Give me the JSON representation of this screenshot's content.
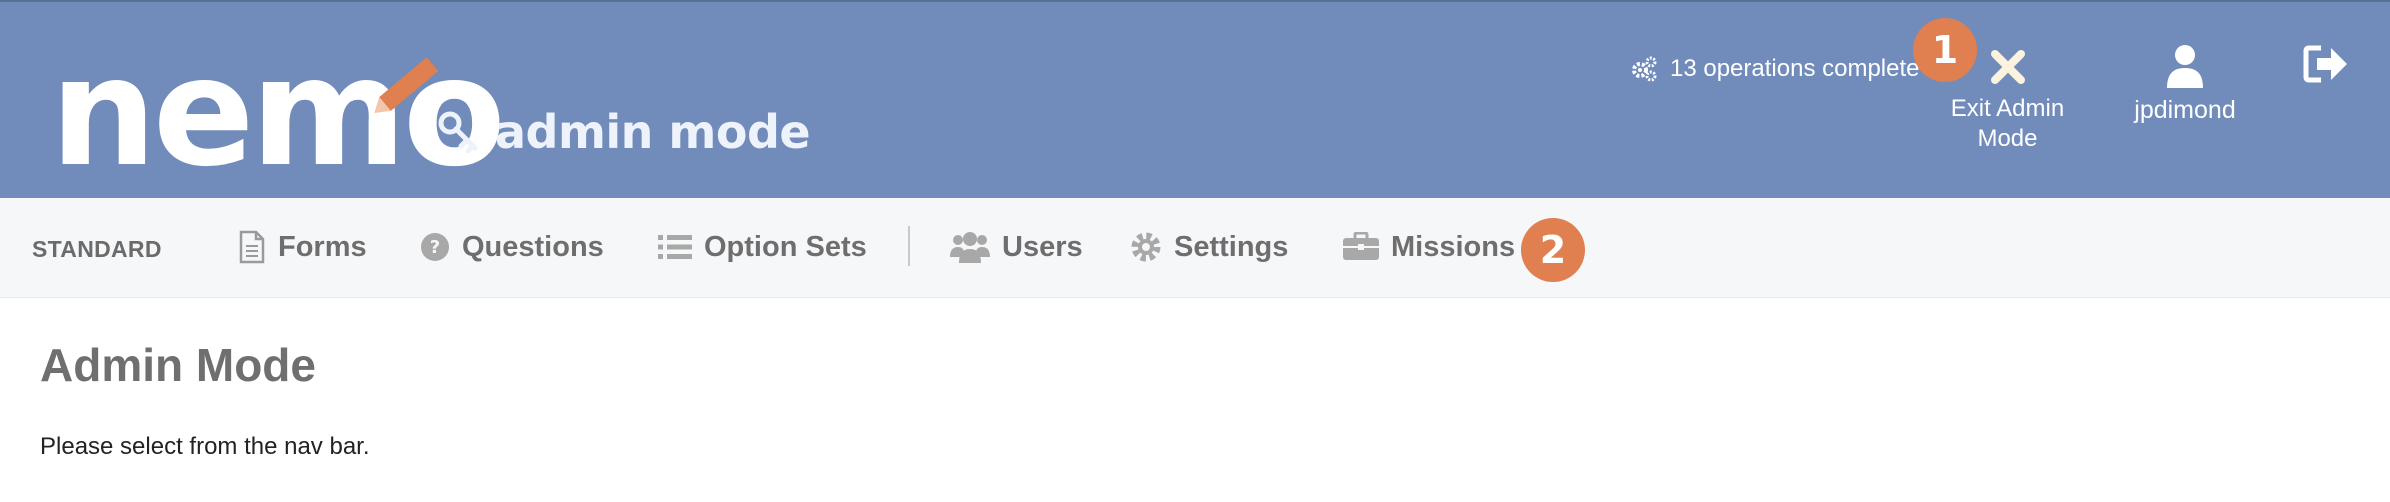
{
  "header": {
    "logo_text": "nemo",
    "mode_label": "admin mode",
    "operations_status": "13 operations complete",
    "exit_admin_label": "Exit Admin Mode",
    "username": "jpdimond",
    "markers": [
      "1",
      "2"
    ],
    "colors": {
      "header_bg": "#718bba",
      "accent": "#e07f4f"
    }
  },
  "nav": {
    "section_label": "STANDARD",
    "items": [
      {
        "label": "Forms",
        "icon": "file-icon"
      },
      {
        "label": "Questions",
        "icon": "question-circle-icon"
      },
      {
        "label": "Option Sets",
        "icon": "list-icon"
      },
      {
        "label": "Users",
        "icon": "users-icon"
      },
      {
        "label": "Settings",
        "icon": "gear-icon"
      },
      {
        "label": "Missions",
        "icon": "briefcase-icon"
      }
    ]
  },
  "main": {
    "title": "Admin Mode",
    "text": "Please select from the nav bar."
  }
}
